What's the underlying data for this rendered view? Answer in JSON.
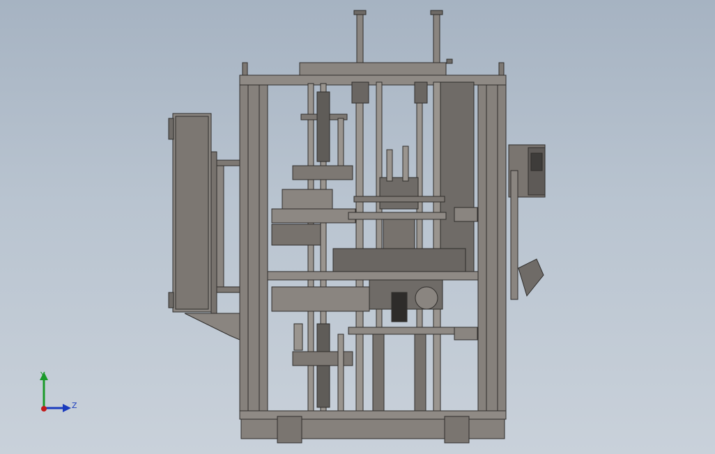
{
  "view": {
    "background_top": "#a6b3c2",
    "background_bottom": "#c9d1da",
    "model_color": "#7a7570",
    "edge_color": "#2e2c2a"
  },
  "triad": {
    "y_label": "Y",
    "z_label": "Z",
    "y_color": "#1a9a2a",
    "z_color": "#1a3bbd",
    "origin_color": "#c21a1a"
  }
}
